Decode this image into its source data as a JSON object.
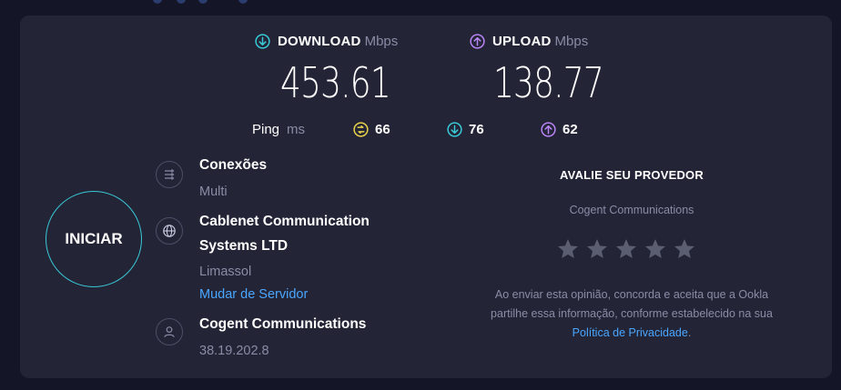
{
  "download": {
    "label": "DOWNLOAD",
    "unit": "Mbps",
    "value": "453.61",
    "icon": "download-icon",
    "color": "#38c9d6"
  },
  "upload": {
    "label": "UPLOAD",
    "unit": "Mbps",
    "value": "138.77",
    "icon": "upload-icon",
    "color": "#b884f4"
  },
  "ping": {
    "label": "Ping",
    "unit": "ms",
    "idle": "66",
    "down": "76",
    "up": "62",
    "idle_color": "#e8d34a"
  },
  "start_button": {
    "label": "INICIAR",
    "ring_color": "#38c9d6"
  },
  "connections": {
    "title": "Conexões",
    "value": "Multi",
    "icon": "connections-icon"
  },
  "server": {
    "name_line1": "Cablenet Communication",
    "name_line2": "Systems LTD",
    "location": "Limassol",
    "change_link": "Mudar de Servidor",
    "icon": "globe-icon"
  },
  "provider": {
    "name": "Cogent Communications",
    "ip": "38.19.202.8",
    "icon": "user-icon"
  },
  "rating": {
    "title": "AVALIE SEU PROVEDOR",
    "provider": "Cogent Communications",
    "stars": 5,
    "selected": 0,
    "disclaimer_line1": "Ao enviar esta opinião, concorda e aceita que a Ookla",
    "disclaimer_line2": "partilhe essa informação, conforme estabelecido na sua",
    "privacy_link": "Política de Privacidade",
    "period": "."
  }
}
